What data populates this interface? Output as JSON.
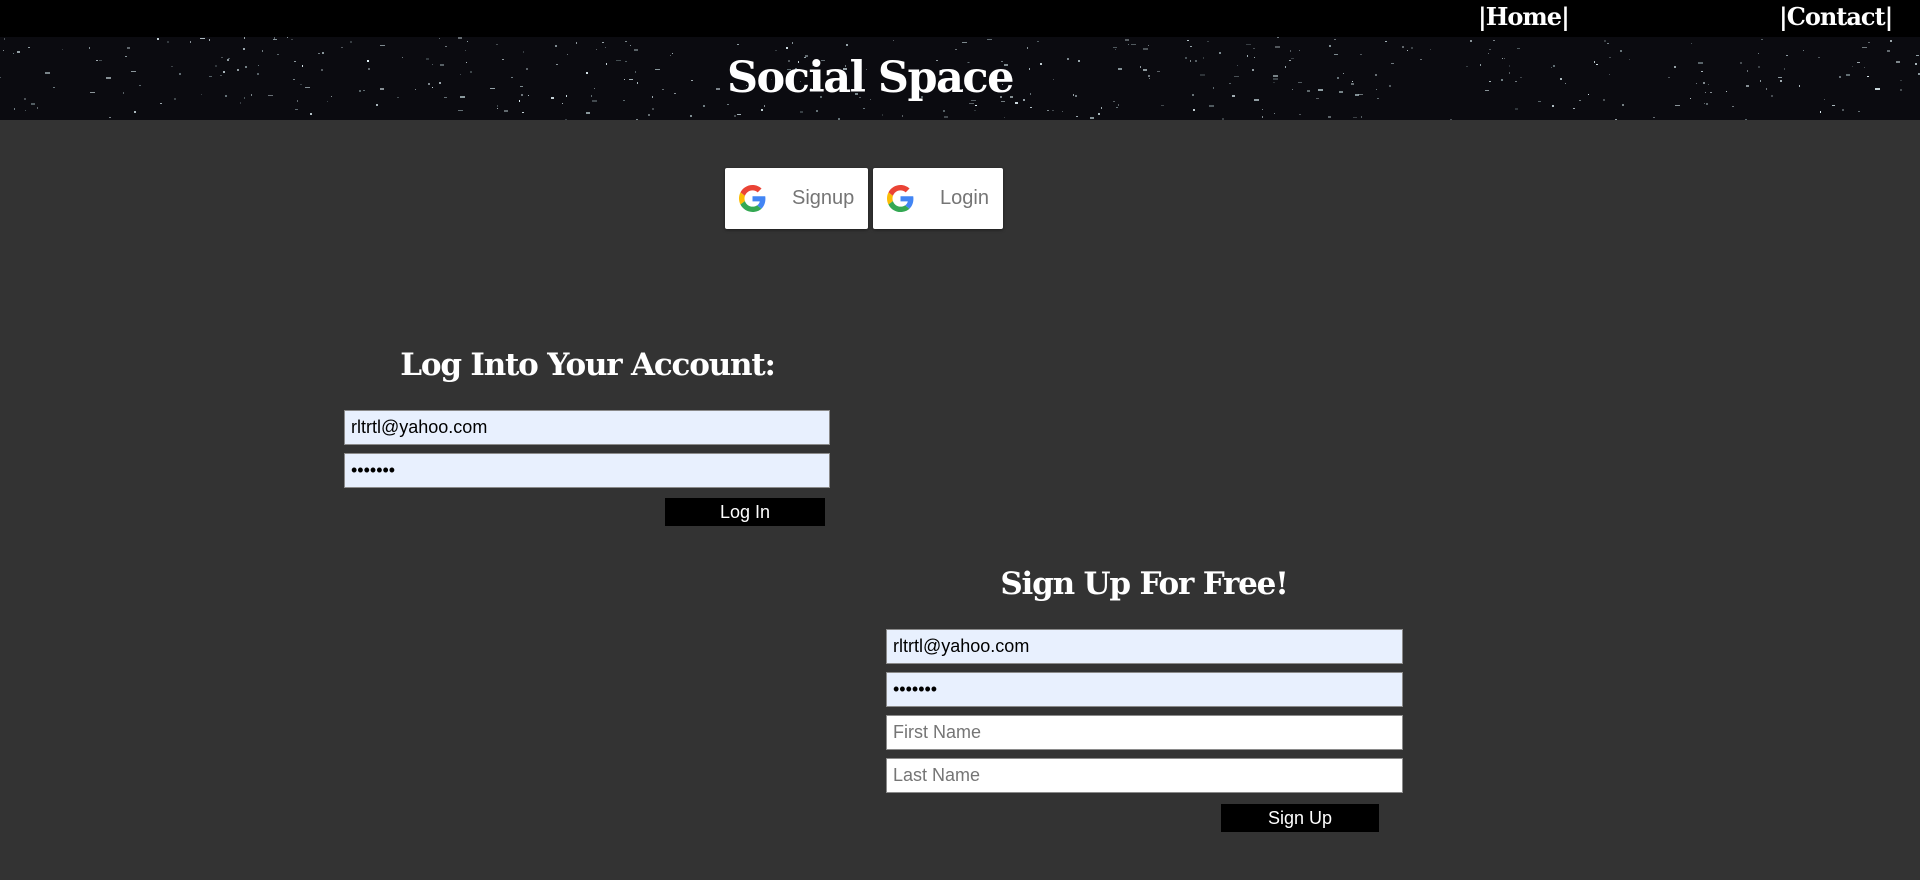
{
  "nav": {
    "home_label": "|Home|",
    "contact_label": "|Contact|"
  },
  "header": {
    "title": "Social Space"
  },
  "oauth": {
    "signup_label": "Signup",
    "login_label": "Login"
  },
  "login": {
    "heading": "Log Into Your Account:",
    "email_value": "rltrtl@yahoo.com",
    "password_value": "1234567",
    "submit_label": "Log In"
  },
  "signup": {
    "heading": "Sign Up For Free!",
    "email_value": "rltrtl@yahoo.com",
    "password_value": "1234567",
    "first_name_placeholder": "First Name",
    "last_name_placeholder": "Last Name",
    "submit_label": "Sign Up"
  },
  "colors": {
    "page_background": "#333333",
    "nav_background": "#000000",
    "banner_background": "#0b0b10",
    "autofill_background": "#e8f0fe",
    "button_background": "#000000",
    "google_button_text": "#757575"
  },
  "icons": {
    "oauth": "google-g-icon"
  }
}
